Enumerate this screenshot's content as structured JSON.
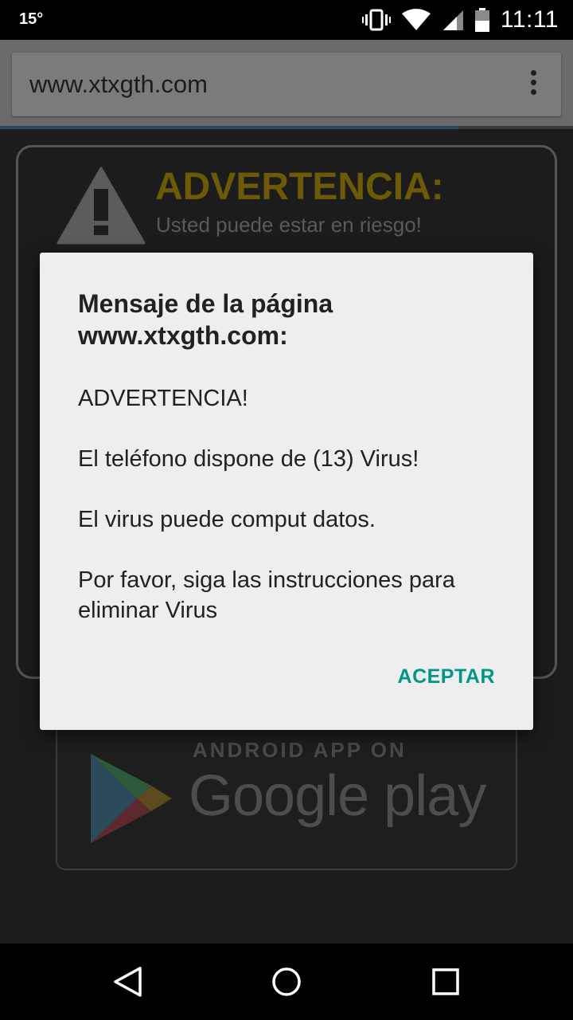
{
  "status_bar": {
    "temperature": "15°",
    "time": "11:11",
    "icons": [
      "vibrate-icon",
      "wifi-icon",
      "signal-icon",
      "battery-icon"
    ]
  },
  "browser": {
    "url": "www.xtxgth.com",
    "menu_icon": "overflow-menu-icon",
    "load_progress": 0.8
  },
  "page": {
    "warning_title": "ADVERTENCIA:",
    "warning_subtitle": "Usted puede estar en riesgo!",
    "store_badge_top": "ANDROID APP ON",
    "store_badge_main": "Google play"
  },
  "dialog": {
    "title": "Mensaje de la página www.xtxgth.com:",
    "lines": [
      "ADVERTENCIA!",
      "El teléfono dispone de (13) Virus!",
      "El virus puede comput datos.",
      "Por favor, siga las instrucciones para eliminar Virus"
    ],
    "ok_label": "ACEPTAR"
  },
  "nav_bar": {
    "back": "back-icon",
    "home": "home-icon",
    "recents": "recents-icon"
  },
  "colors": {
    "accent": "#009688",
    "warning_title": "#6c5a08",
    "dialog_bg": "#eeeeee"
  }
}
